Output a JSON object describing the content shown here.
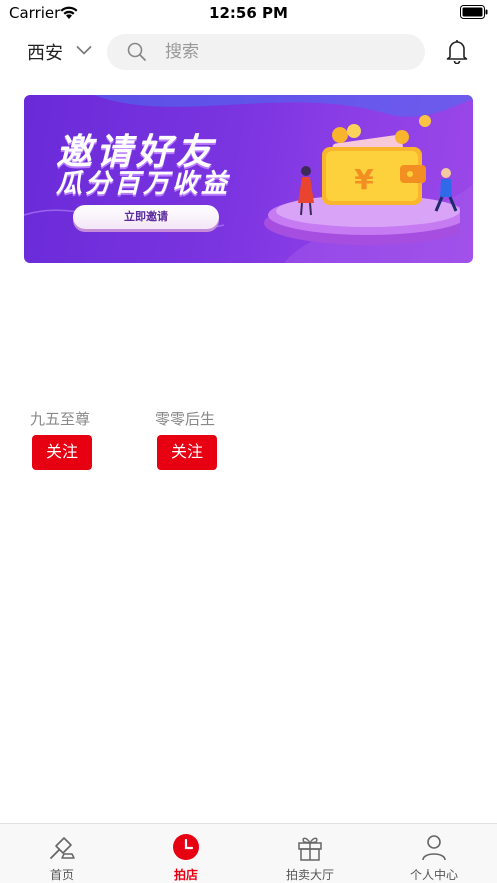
{
  "status_bar": {
    "carrier": "Carrier",
    "time": "12:56 PM"
  },
  "header": {
    "city": "西安",
    "search_placeholder": "搜索"
  },
  "banner": {
    "title": "邀请好友",
    "subtitle": "瓜分百万收益",
    "button_label": "立即邀请",
    "currency_symbol": "¥"
  },
  "shops": [
    {
      "name": "九五至尊",
      "follow_label": "关注"
    },
    {
      "name": "零零后生",
      "follow_label": "关注"
    }
  ],
  "tab_bar": {
    "items": [
      {
        "label": "首页",
        "icon": "auction-hammer-icon",
        "active": false
      },
      {
        "label": "拍店",
        "icon": "clock-icon",
        "active": true
      },
      {
        "label": "拍卖大厅",
        "icon": "gift-icon",
        "active": false
      },
      {
        "label": "个人中心",
        "icon": "person-icon",
        "active": false
      }
    ]
  },
  "colors": {
    "accent": "#e60012",
    "banner_start": "#6a2ad8",
    "banner_end": "#9b48e8"
  }
}
